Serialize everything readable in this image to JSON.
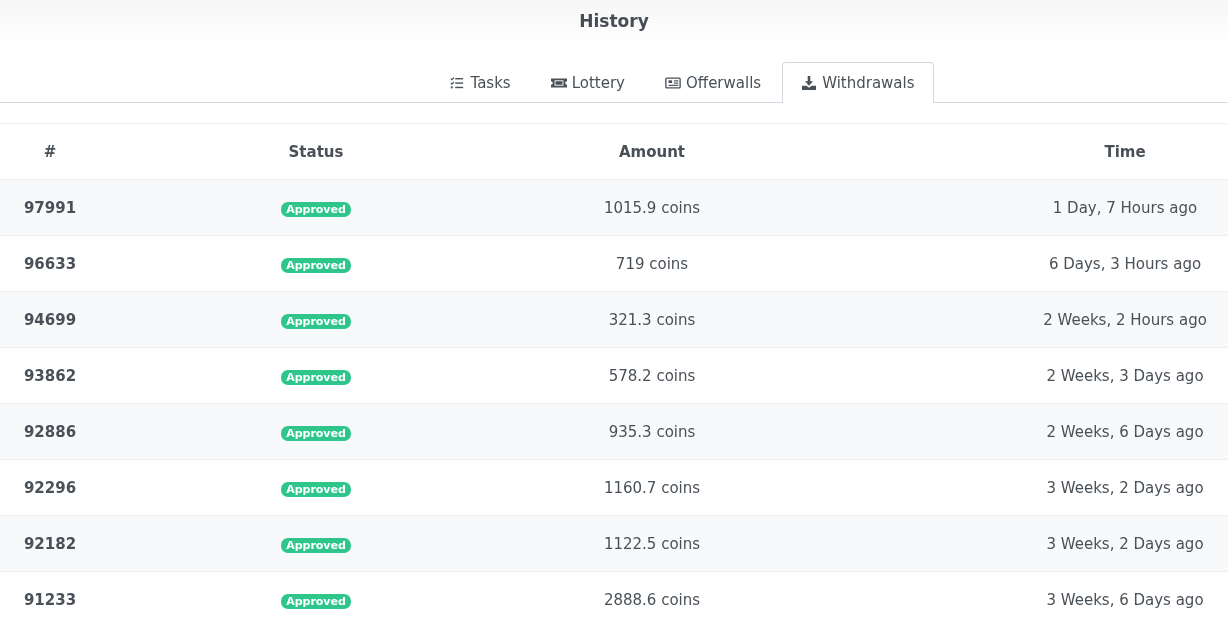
{
  "title": "History",
  "tabs": [
    {
      "label": "Tasks",
      "kind": "tasks",
      "selected": false
    },
    {
      "label": "Lottery",
      "kind": "ticket",
      "selected": false
    },
    {
      "label": "Offerwalls",
      "kind": "news",
      "selected": false
    },
    {
      "label": "Withdrawals",
      "kind": "download",
      "selected": true
    }
  ],
  "table": {
    "columns": [
      "#",
      "Status",
      "Amount",
      "Time"
    ],
    "rows": [
      {
        "id": "97991",
        "status": "Approved",
        "amount": "1015.9 coins",
        "time": "1 Day, 7 Hours ago"
      },
      {
        "id": "96633",
        "status": "Approved",
        "amount": "719 coins",
        "time": "6 Days, 3 Hours ago"
      },
      {
        "id": "94699",
        "status": "Approved",
        "amount": "321.3 coins",
        "time": "2 Weeks, 2 Hours ago"
      },
      {
        "id": "93862",
        "status": "Approved",
        "amount": "578.2 coins",
        "time": "2 Weeks, 3 Days ago"
      },
      {
        "id": "92886",
        "status": "Approved",
        "amount": "935.3 coins",
        "time": "2 Weeks, 6 Days ago"
      },
      {
        "id": "92296",
        "status": "Approved",
        "amount": "1160.7 coins",
        "time": "3 Weeks, 2 Days ago"
      },
      {
        "id": "92182",
        "status": "Approved",
        "amount": "1122.5 coins",
        "time": "3 Weeks, 2 Days ago"
      },
      {
        "id": "91233",
        "status": "Approved",
        "amount": "2888.6 coins",
        "time": "3 Weeks, 6 Days ago"
      }
    ]
  }
}
